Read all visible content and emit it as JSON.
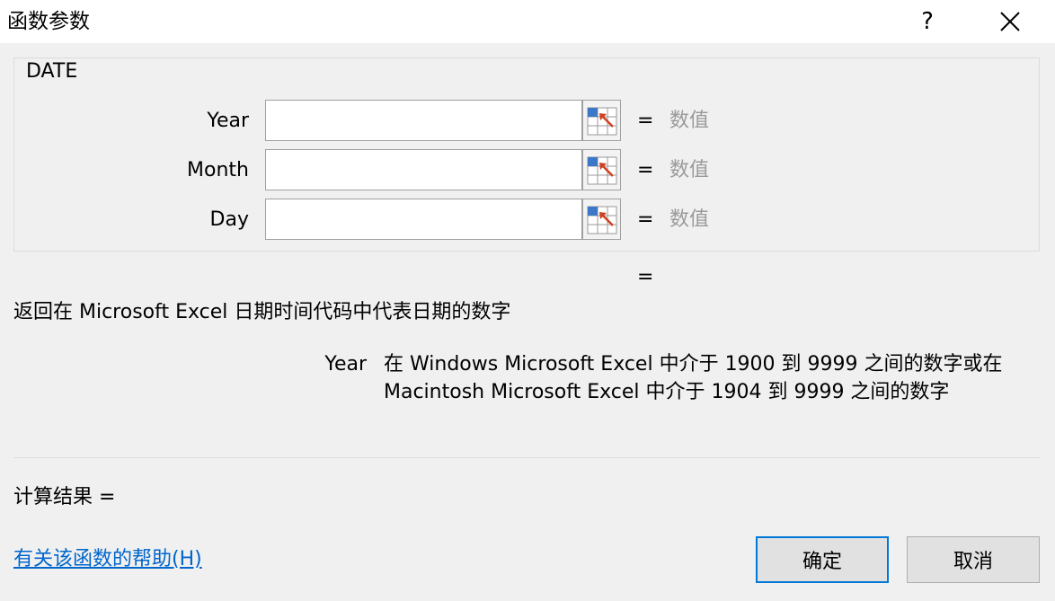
{
  "window": {
    "title": "函数参数",
    "help_label": "?",
    "close_icon": "close-icon"
  },
  "function": {
    "name": "DATE",
    "description": "返回在 Microsoft Excel 日期时间代码中代表日期的数字"
  },
  "arguments": [
    {
      "label": "Year",
      "value": "",
      "hint": "数值"
    },
    {
      "label": "Month",
      "value": "",
      "hint": "数值"
    },
    {
      "label": "Day",
      "value": "",
      "hint": "数值"
    }
  ],
  "equals_sign": "=",
  "param_help": {
    "name": "Year",
    "line1": "在 Windows Microsoft Excel 中介于 1900 到 9999 之间的数字或在",
    "line2": "Macintosh Microsoft Excel 中介于 1904 到 9999 之间的数字"
  },
  "calc_result_label": "计算结果 =",
  "help_link": "有关该函数的帮助(H)",
  "buttons": {
    "ok": "确定",
    "cancel": "取消"
  },
  "colors": {
    "link": "#0066cc",
    "hint": "#9a9a9a",
    "ok_border": "#0078d7",
    "ref_icon_blue": "#3c78c8",
    "ref_icon_red": "#d04020"
  }
}
